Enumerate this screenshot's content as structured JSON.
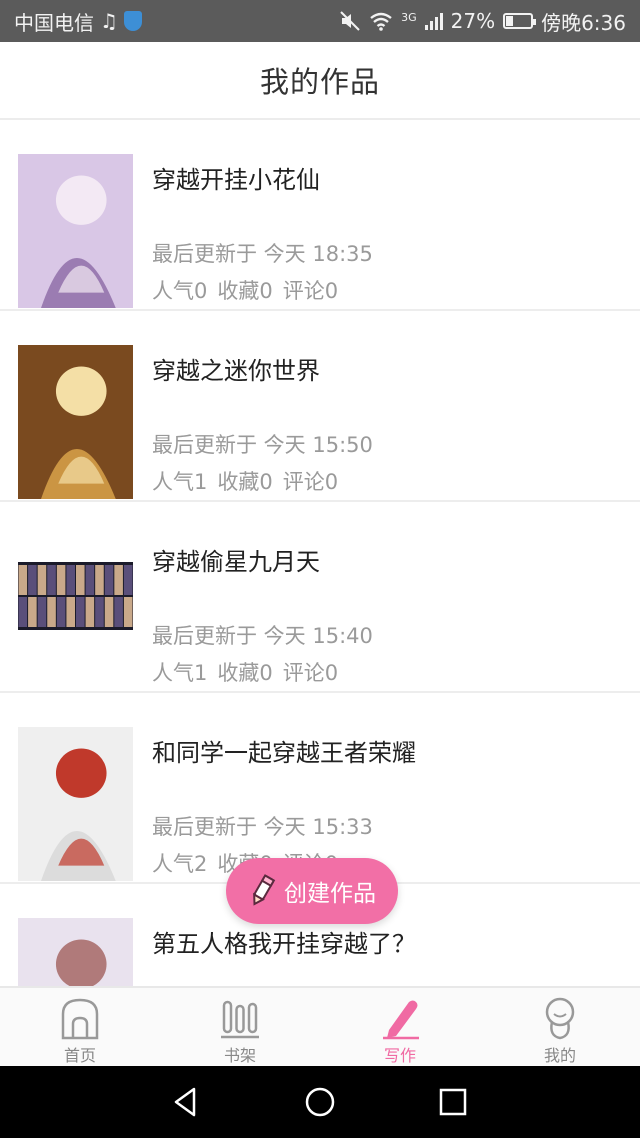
{
  "status_bar": {
    "carrier": "中国电信",
    "network_type": "3G",
    "battery_percent": "27%",
    "battery_level": 0.27,
    "time": "傍晚6:36",
    "icons": [
      "music-icon",
      "shield-icon",
      "mute-icon",
      "wifi-icon",
      "signal-icon",
      "battery-icon"
    ]
  },
  "header": {
    "title": "我的作品"
  },
  "works": [
    {
      "title": "穿越开挂小花仙",
      "updated": "最后更新于 今天 18:35",
      "popularity": "人气0",
      "favorites": "收藏0",
      "comments": "评论0",
      "cover_colors": [
        "#d9c7e6",
        "#8f6fa8",
        "#f3e9f4"
      ]
    },
    {
      "title": "穿越之迷你世界",
      "updated": "最后更新于 今天 15:50",
      "popularity": "人气1",
      "favorites": "收藏0",
      "comments": "评论0",
      "cover_colors": [
        "#7a4a1f",
        "#d9a24a",
        "#f4dfa6"
      ]
    },
    {
      "title": "穿越偷星九月天",
      "updated": "最后更新于 今天 15:40",
      "popularity": "人气1",
      "favorites": "收藏0",
      "comments": "评论0",
      "cover_colors": [
        "#1b1b2a",
        "#5a4f7a",
        "#c9a98a"
      ]
    },
    {
      "title": "和同学一起穿越王者荣耀",
      "updated": "最后更新于 今天 15:33",
      "popularity": "人气2",
      "favorites": "收藏0",
      "comments": "评论0",
      "cover_colors": [
        "#efefef",
        "#d8d8d8",
        "#c0392b"
      ]
    },
    {
      "title": "第五人格我开挂穿越了？",
      "updated": "",
      "popularity": "",
      "favorites": "",
      "comments": "",
      "cover_colors": [
        "#e9e2ee",
        "#8c6a9c",
        "#b07a7a"
      ]
    }
  ],
  "fab": {
    "label": "创建作品",
    "icon": "pencil-icon",
    "color": "#f26fa6"
  },
  "tabs": [
    {
      "label": "首页",
      "icon": "home-icon",
      "active": false
    },
    {
      "label": "书架",
      "icon": "bookshelf-icon",
      "active": false
    },
    {
      "label": "写作",
      "icon": "pen-icon",
      "active": true
    },
    {
      "label": "我的",
      "icon": "profile-icon",
      "active": false
    }
  ],
  "accent_color": "#f06aa3",
  "system_nav": {
    "icons": [
      "back-icon",
      "home-circle-icon",
      "recents-icon"
    ]
  }
}
